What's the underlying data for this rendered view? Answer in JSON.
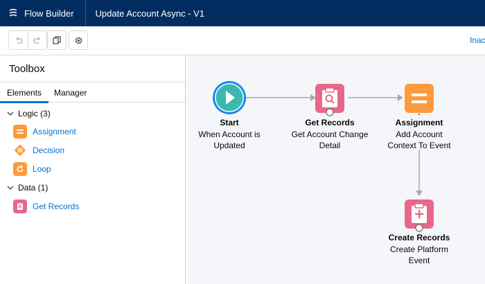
{
  "header": {
    "app_name": "Flow Builder",
    "flow_title": "Update Account Async - V1"
  },
  "toolbar": {
    "buttons": [
      "undo-icon",
      "redo-icon",
      "copy-icon",
      "gear-icon"
    ],
    "status_text": "Inac"
  },
  "toolbox": {
    "title": "Toolbox",
    "tabs": [
      {
        "label": "Elements",
        "active": true
      },
      {
        "label": "Manager",
        "active": false
      }
    ],
    "sections": [
      {
        "label": "Logic (3)",
        "items": [
          {
            "label": "Assignment",
            "icon": "assignment-icon",
            "color": "#ff9a3c"
          },
          {
            "label": "Decision",
            "icon": "decision-icon",
            "color": "#ff9a3c"
          },
          {
            "label": "Loop",
            "icon": "loop-icon",
            "color": "#ff9a3c"
          }
        ]
      },
      {
        "label": "Data (1)",
        "items": [
          {
            "label": "Get Records",
            "icon": "get-records-icon",
            "color": "#e8678a"
          }
        ]
      }
    ]
  },
  "canvas": {
    "nodes": [
      {
        "id": "start",
        "title": "Start",
        "subtitle_line1": "When Account is",
        "subtitle_line2": "Updated",
        "icon": "play-icon",
        "color": "#3bb8b0"
      },
      {
        "id": "get-records",
        "title": "Get Records",
        "subtitle_line1": "Get Account Change",
        "subtitle_line2": "Detail",
        "icon": "get-records-icon",
        "color": "#e8678a"
      },
      {
        "id": "assignment",
        "title": "Assignment",
        "subtitle_line1": "Add Account",
        "subtitle_line2": "Context To Event",
        "icon": "assignment-icon",
        "color": "#ff9a3c"
      },
      {
        "id": "create-records",
        "title": "Create Records",
        "subtitle_line1": "Create Platform",
        "subtitle_line2": "Event",
        "icon": "create-records-icon",
        "color": "#e8678a"
      }
    ],
    "connector_color": "#a8a8a8"
  }
}
